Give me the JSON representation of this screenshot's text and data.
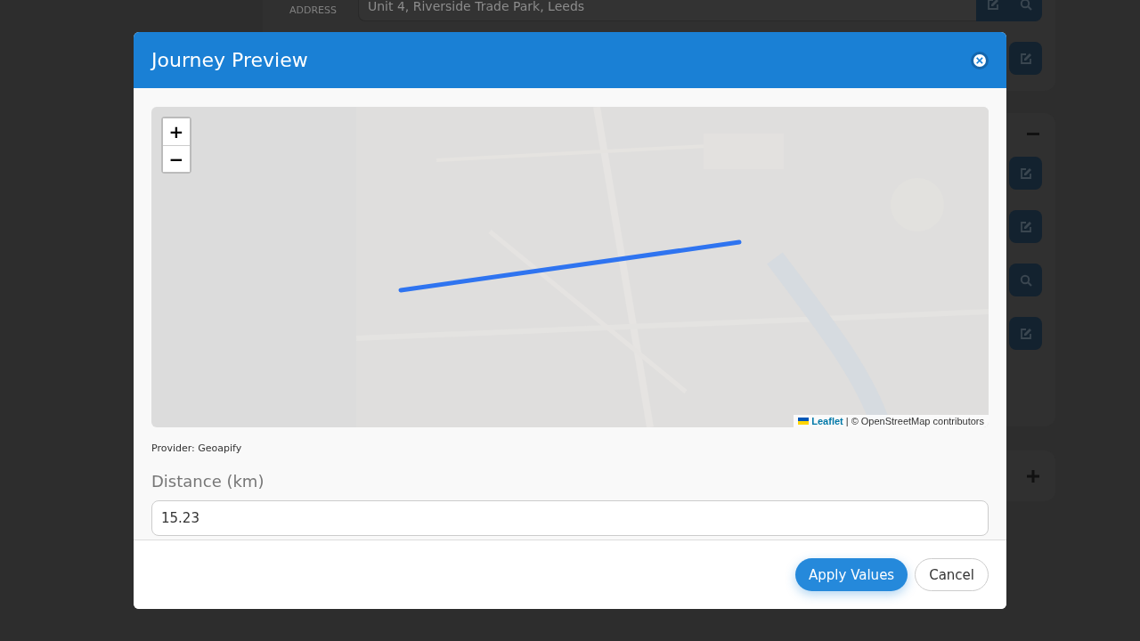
{
  "background": {
    "address": {
      "label": "ADDRESS",
      "value": "Unit 4, Riverside Trade Park, Leeds"
    },
    "first_card_actions": [
      {
        "kind": "edit"
      }
    ],
    "second_card": {
      "expanded": true,
      "actions": [
        {
          "kind": "edit"
        },
        {
          "kind": "edit"
        },
        {
          "kind": "search"
        },
        {
          "kind": "edit"
        }
      ]
    },
    "third_card": {
      "expanded": false
    }
  },
  "modal": {
    "title": "Journey Preview",
    "close": "×",
    "map": {
      "zoom_in": "+",
      "zoom_out": "−",
      "attribution_link": "Leaflet",
      "attribution_text": "| © OpenStreetMap contributors"
    },
    "provider": "Provider: Geoapify",
    "field": {
      "label": "Distance (km)",
      "value": "15.23"
    },
    "buttons": [
      {
        "label": "Apply Values",
        "kind": "primary"
      },
      {
        "label": "Cancel",
        "kind": "secondary"
      }
    ]
  }
}
